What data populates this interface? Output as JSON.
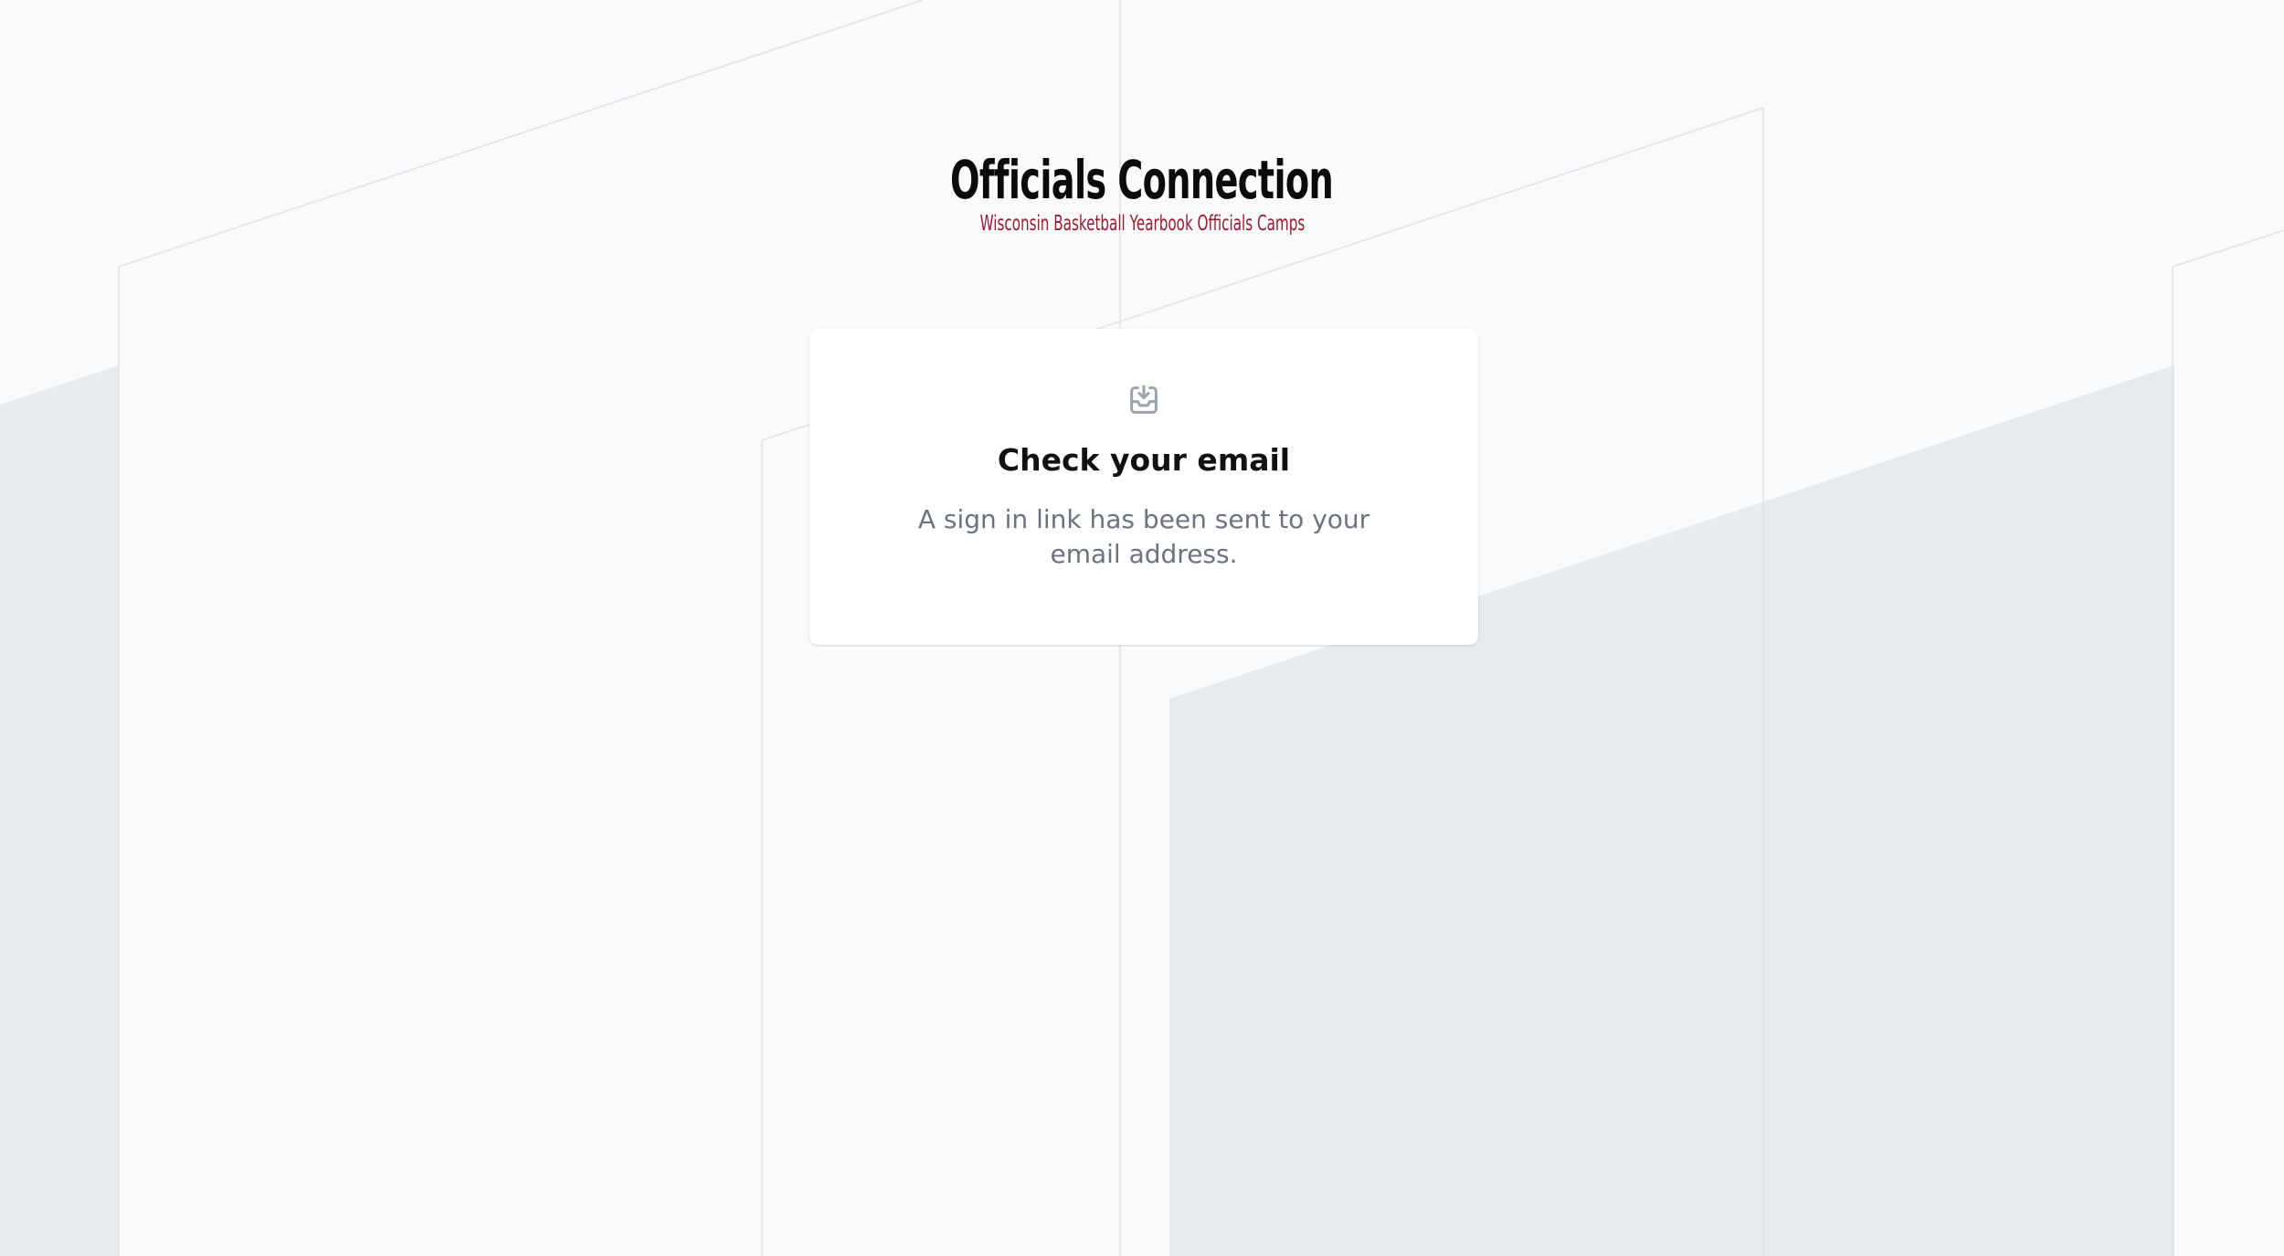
{
  "brand": {
    "title": "Officials Connection",
    "subtitle": "Wisconsin Basketball Yearbook Officials Camps"
  },
  "card": {
    "icon": "inbox-download-icon",
    "title": "Check your email",
    "message": "A sign in link has been sent to your email address."
  },
  "colors": {
    "background": "#f9fafb",
    "card": "#ffffff",
    "title": "#0b0b0b",
    "subtitle_accent": "#a0182d",
    "muted_text": "#6b7280",
    "icon": "#9ca3af"
  }
}
